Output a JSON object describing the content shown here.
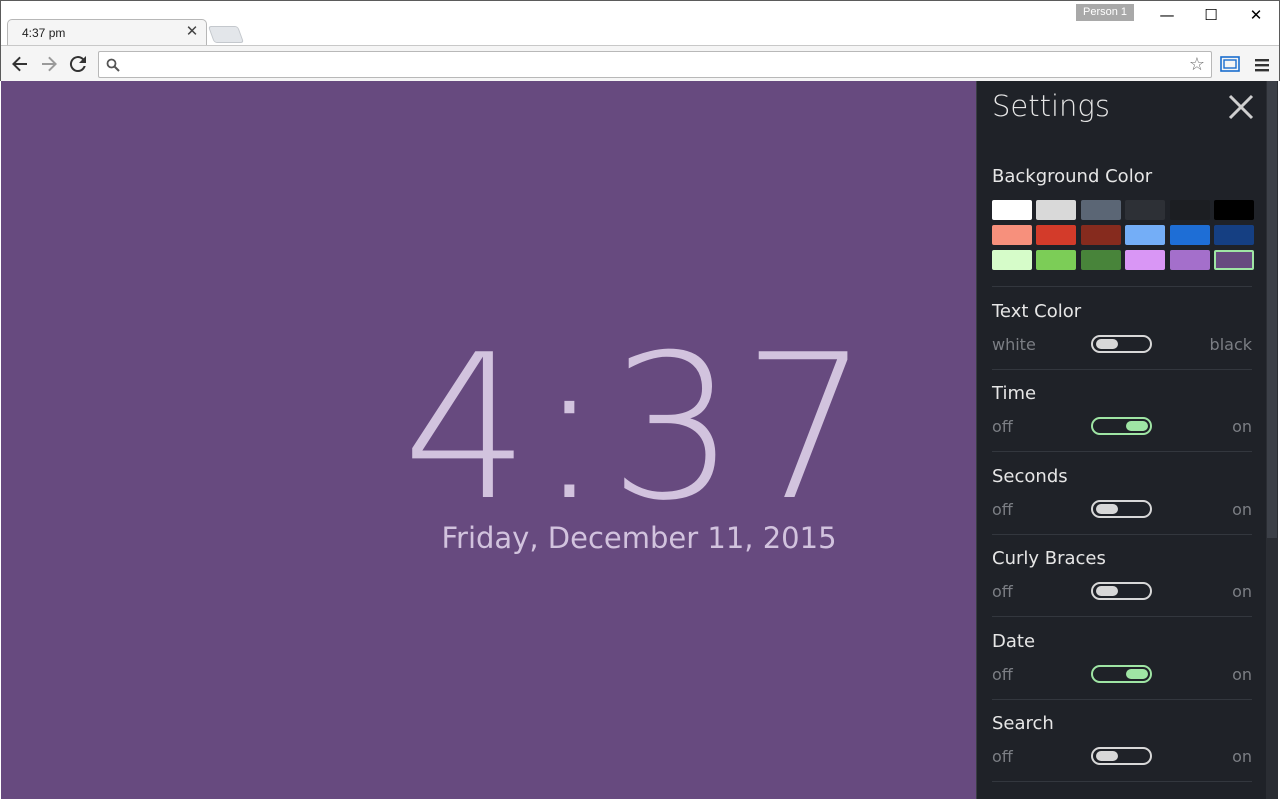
{
  "browser": {
    "tab_title": "4:37 pm",
    "profile": "Person 1",
    "address": "",
    "icons": {
      "tab_close": "close-icon",
      "back": "back-arrow-icon",
      "forward": "forward-arrow-icon",
      "reload": "reload-icon",
      "search": "search-icon",
      "star": "star-icon",
      "cast": "cast-icon",
      "menu": "hamburger-menu-icon"
    }
  },
  "page": {
    "background": "#674a7f",
    "time": "4:37",
    "date": "Friday, December 11, 2015"
  },
  "settings": {
    "title": "Settings",
    "background_color": {
      "label": "Background Color",
      "swatches": [
        [
          "#ffffff",
          "#d9d9d9",
          "#5b6675",
          "#2d3036",
          "#1c1e22",
          "#000000"
        ],
        [
          "#f7907c",
          "#d33b2a",
          "#862b1e",
          "#74aef7",
          "#1e6ed6",
          "#153f82"
        ],
        [
          "#d6fcc9",
          "#7ccd57",
          "#48843a",
          "#d996f5",
          "#a46fcb",
          "#674a7f"
        ]
      ],
      "selected": "#674a7f"
    },
    "text_color": {
      "label": "Text Color",
      "left": "white",
      "right": "black",
      "state": "white"
    },
    "options": [
      {
        "label": "Time",
        "off": "off",
        "on": "on",
        "enabled": true
      },
      {
        "label": "Seconds",
        "off": "off",
        "on": "on",
        "enabled": false
      },
      {
        "label": "Curly Braces",
        "off": "off",
        "on": "on",
        "enabled": false
      },
      {
        "label": "Date",
        "off": "off",
        "on": "on",
        "enabled": true
      },
      {
        "label": "Search",
        "off": "off",
        "on": "on",
        "enabled": false
      }
    ]
  }
}
